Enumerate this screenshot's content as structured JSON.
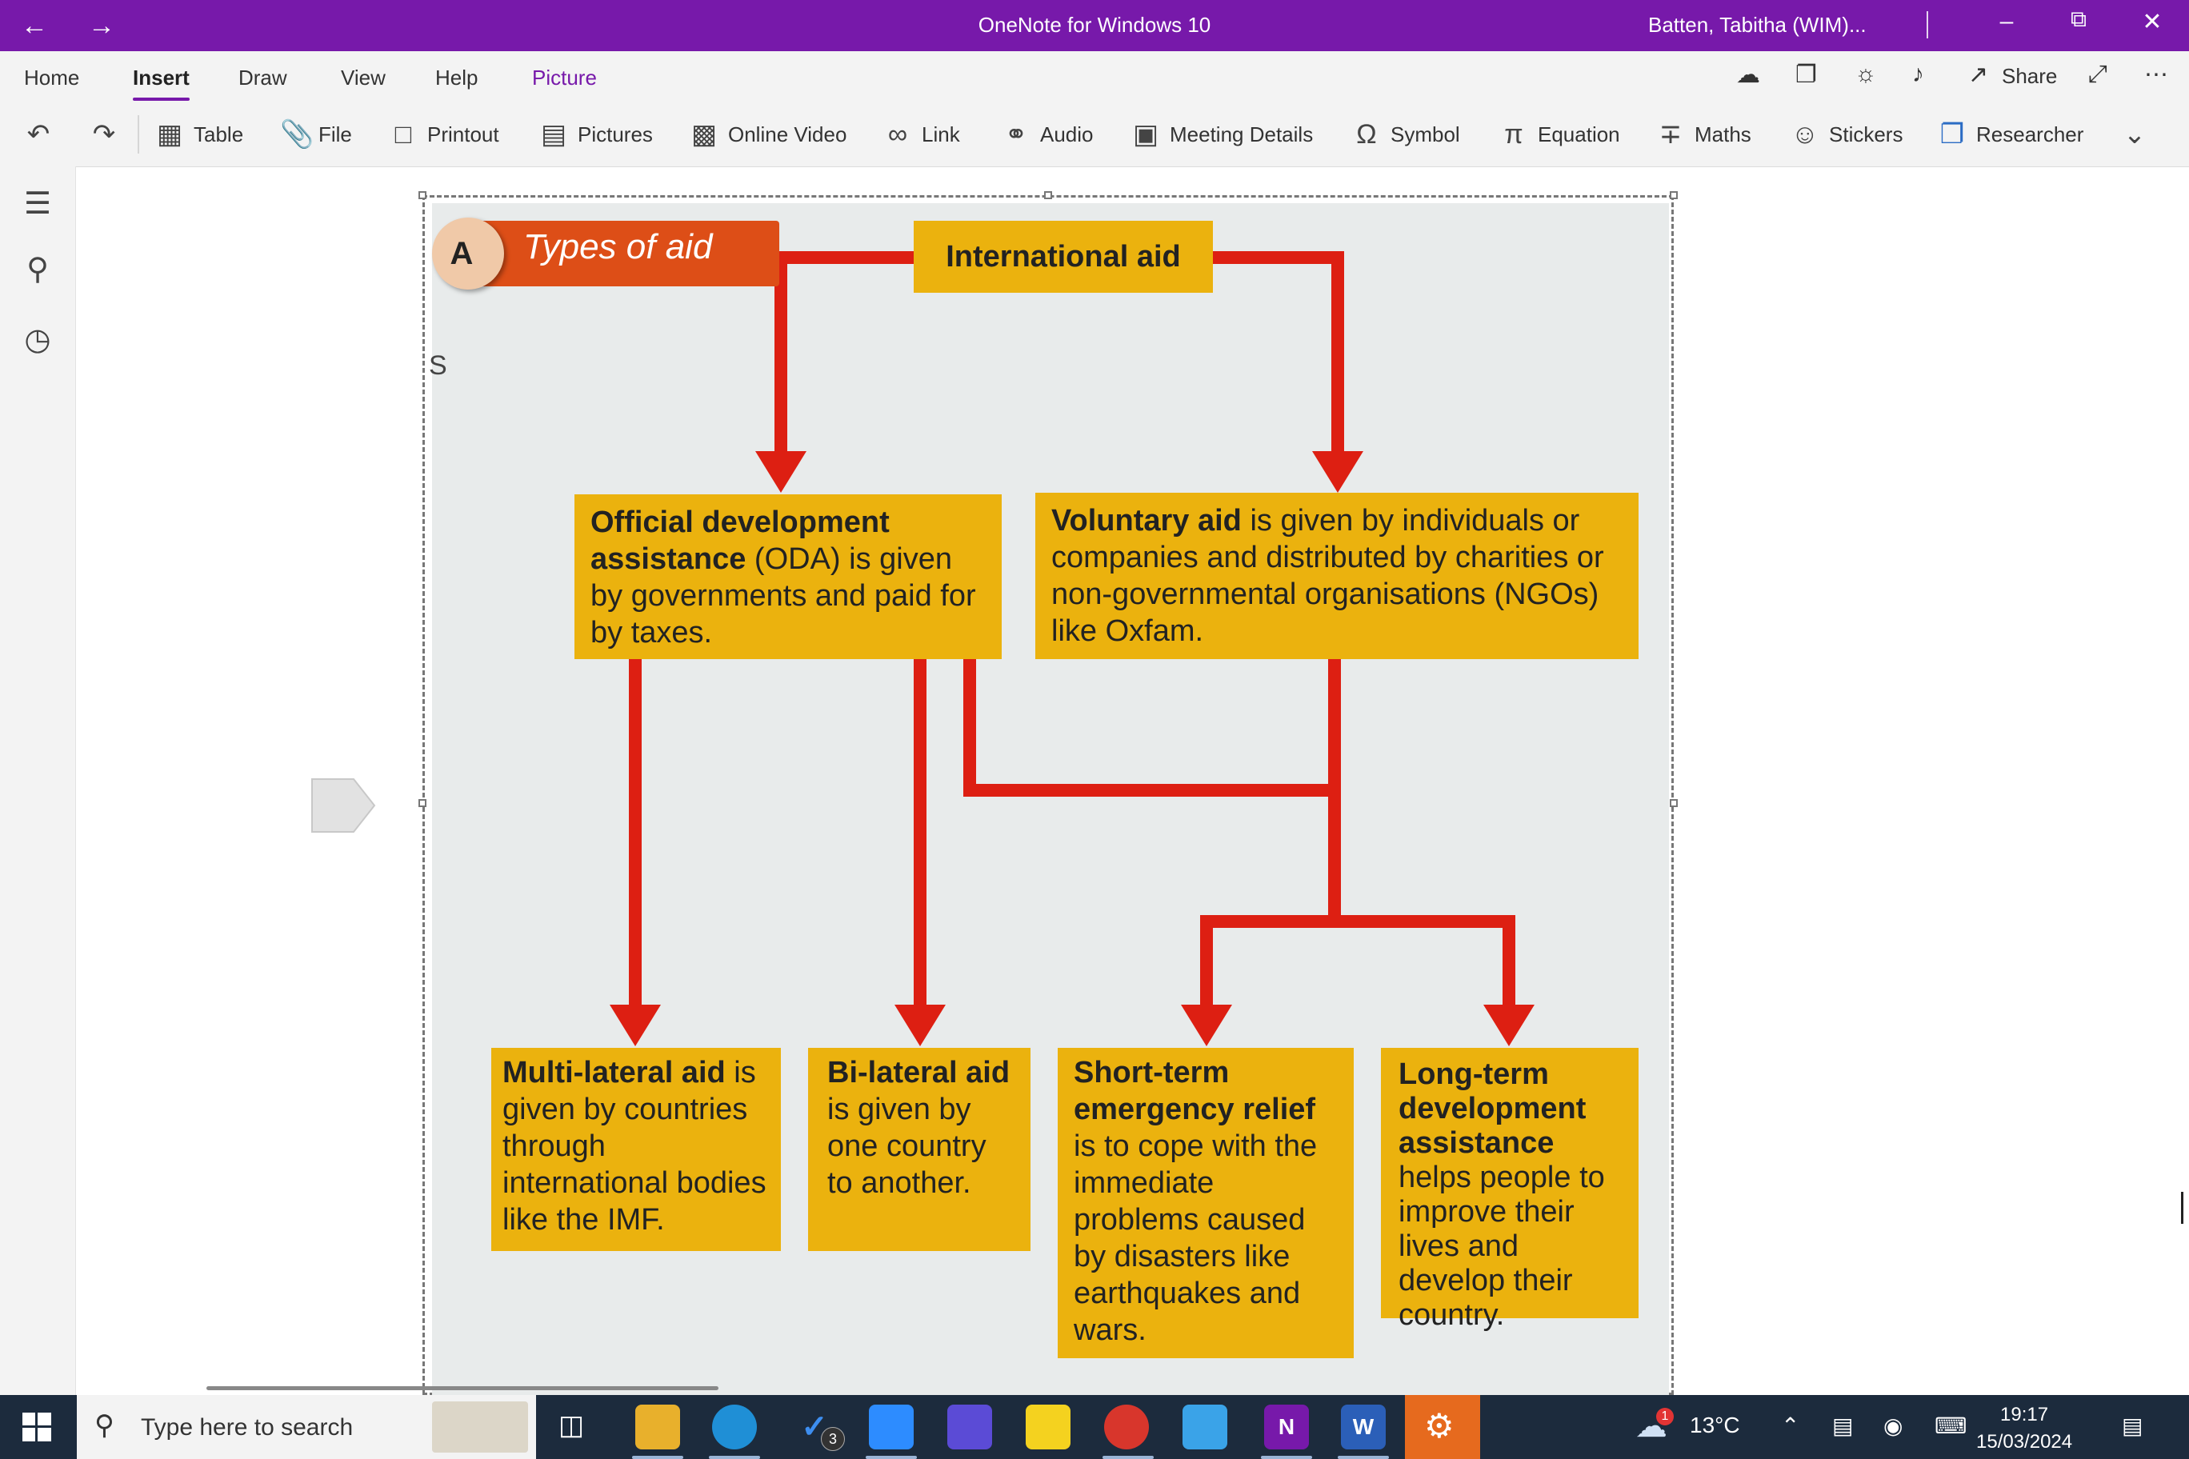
{
  "colors": {
    "title_bar": "#7719aa",
    "arrow_red": "#dd1f12",
    "box_yellow": "#ebb20e",
    "badge_orange": "#dd4e17",
    "taskbar": "#1c2b3d"
  },
  "titlebar": {
    "title": "OneNote for Windows 10",
    "user": "Batten, Tabitha (WIM)...",
    "back_icon": "arrow-left",
    "forward_icon": "arrow-right"
  },
  "menu": {
    "tabs": [
      "Home",
      "Insert",
      "Draw",
      "View",
      "Help",
      "Picture"
    ],
    "active": "Insert",
    "share_label": "Share"
  },
  "ribbon": {
    "items": [
      "Table",
      "File",
      "Printout",
      "Pictures",
      "Online Video",
      "Link",
      "Audio",
      "Meeting Details",
      "Symbol",
      "Equation",
      "Maths",
      "Stickers",
      "Researcher"
    ]
  },
  "diagram": {
    "badge_letter": "A",
    "badge_title": "Types of aid",
    "root": "International aid",
    "cursor_text": "S",
    "oda": {
      "bold": "Official development assistance",
      "text": " (ODA) is given by governments and paid for by taxes."
    },
    "voluntary": {
      "bold": "Voluntary aid",
      "text": " is given by individuals or companies and distributed by charities or non-governmental organisations (NGOs) like Oxfam."
    },
    "multilateral": {
      "bold": "Multi-lateral aid",
      "text": " is given by countries through international bodies like the IMF."
    },
    "bilateral": {
      "bold": "Bi-lateral aid",
      "text": " is given by one country to another."
    },
    "shortterm": {
      "bold": "Short-term emergency relief",
      "text": " is to cope with the immediate problems caused by disasters like earthquakes and wars."
    },
    "longterm": {
      "bold": "Long-term development assistance",
      "text": " helps people to improve their lives and develop their country."
    }
  },
  "taskbar": {
    "search_placeholder": "Type here to search",
    "todo_badge": "3",
    "weather_badge": "1",
    "temperature": "13°C",
    "time": "19:17",
    "date": "15/03/2024",
    "onenote_letter": "N",
    "word_letter": "W"
  }
}
